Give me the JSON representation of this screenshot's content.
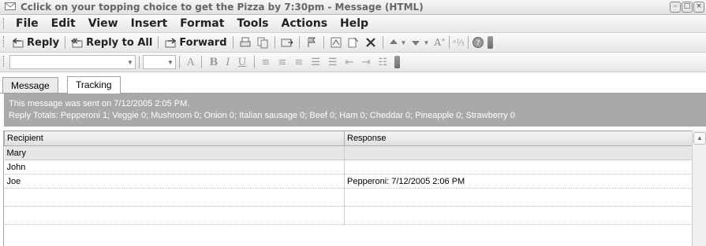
{
  "window": {
    "title": "Cclick on your topping choice to get the Pizza by 7:30pm  - Message (HTML)",
    "icon": "envelope-icon",
    "controls": [
      "minimize",
      "maximize",
      "close"
    ]
  },
  "menubar": {
    "items": [
      "File",
      "Edit",
      "View",
      "Insert",
      "Format",
      "Tools",
      "Actions",
      "Help"
    ]
  },
  "toolbar": {
    "reply_label": "Reply",
    "reply_all_label": "Reply to All",
    "forward_label": "Forward"
  },
  "tabs": [
    {
      "label": "Message"
    },
    {
      "label": "Tracking"
    }
  ],
  "tracking": {
    "sent_line": "This message was sent on 7/12/2005 2:05 PM.",
    "totals_line": "Reply Totals: Pepperoni 1; Veggie 0; Mushroom 0; Onion 0; Italian sausage 0; Beef 0; Ham 0; Cheddar 0; Pineapple 0; Strawberry 0",
    "columns": [
      "Recipient",
      "Response"
    ],
    "rows": [
      {
        "recipient": "Mary",
        "response": ""
      },
      {
        "recipient": "John",
        "response": ""
      },
      {
        "recipient": "Joe",
        "response": "Pepperoni: 7/12/2005 2:06 PM"
      }
    ]
  },
  "colors": {
    "info_bar": "#a9a9a9",
    "selected_row": "#e6e6e6"
  }
}
